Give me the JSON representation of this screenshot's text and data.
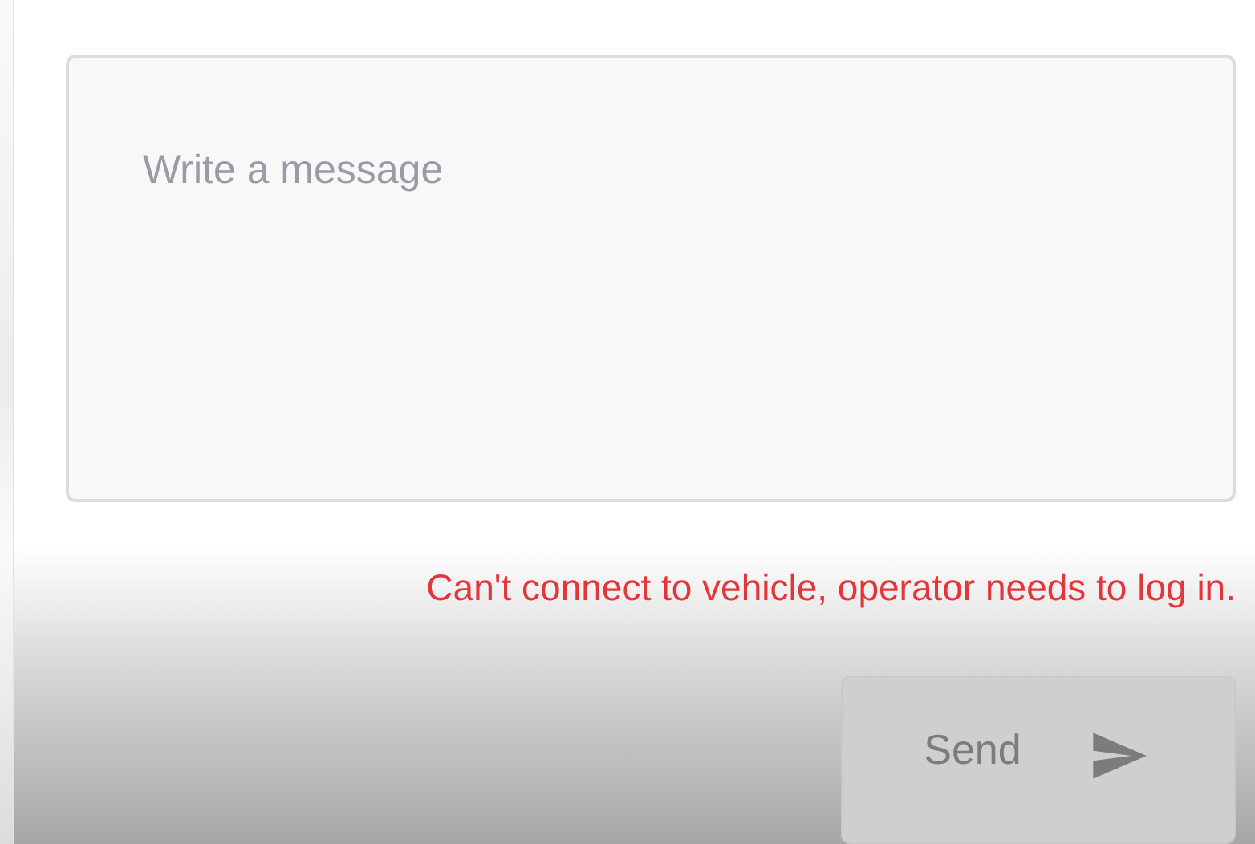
{
  "message_field": {
    "placeholder": "Write a message"
  },
  "error": "Can't connect to vehicle, operator needs to log in.",
  "send_button": {
    "label": "Send",
    "disabled": true
  }
}
